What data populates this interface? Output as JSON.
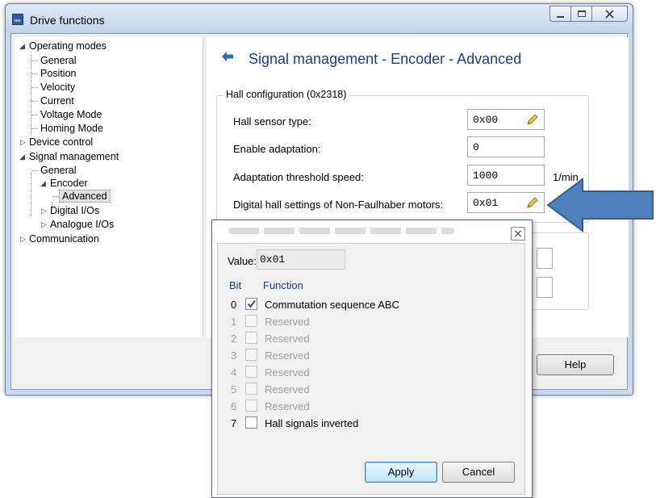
{
  "window": {
    "title": "Drive functions"
  },
  "tree": {
    "items": [
      {
        "label": "Operating modes",
        "expanded": true
      },
      {
        "label": "General"
      },
      {
        "label": "Position"
      },
      {
        "label": "Velocity"
      },
      {
        "label": "Current"
      },
      {
        "label": "Voltage Mode"
      },
      {
        "label": "Homing Mode"
      },
      {
        "label": "Device control",
        "expanded": false
      },
      {
        "label": "Signal management",
        "expanded": true
      },
      {
        "label": "General"
      },
      {
        "label": "Encoder",
        "expanded": true
      },
      {
        "label": "Advanced",
        "selected": true
      },
      {
        "label": "Digital I/Os",
        "expanded": false
      },
      {
        "label": "Analogue I/Os",
        "expanded": false
      },
      {
        "label": "Communication",
        "expanded": false
      }
    ]
  },
  "panel": {
    "title": "Signal management - Encoder - Advanced",
    "group_title": "Hall configuration (0x2318)",
    "fields": [
      {
        "label": "Hall sensor type:",
        "value": "0x00",
        "editable": true
      },
      {
        "label": "Enable adaptation:",
        "value": "0"
      },
      {
        "label": "Adaptation threshold speed:",
        "value": "1000",
        "unit": "1/min"
      },
      {
        "label": "Digital hall settings of Non-Faulhaber motors:",
        "value": "0x01",
        "editable": true
      }
    ],
    "help_label": "Help"
  },
  "dialog": {
    "value_label": "Value:",
    "value": "0x01",
    "col_bit": "Bit",
    "col_function": "Function",
    "bits": [
      {
        "bit": "0",
        "name": "Commutation sequence ABC",
        "checked": true,
        "enabled": true
      },
      {
        "bit": "1",
        "name": "Reserved",
        "checked": false,
        "enabled": false
      },
      {
        "bit": "2",
        "name": "Reserved",
        "checked": false,
        "enabled": false
      },
      {
        "bit": "3",
        "name": "Reserved",
        "checked": false,
        "enabled": false
      },
      {
        "bit": "4",
        "name": "Reserved",
        "checked": false,
        "enabled": false
      },
      {
        "bit": "5",
        "name": "Reserved",
        "checked": false,
        "enabled": false
      },
      {
        "bit": "6",
        "name": "Reserved",
        "checked": false,
        "enabled": false
      },
      {
        "bit": "7",
        "name": "Hall signals inverted",
        "checked": false,
        "enabled": true
      }
    ],
    "apply_label": "Apply",
    "cancel_label": "Cancel"
  },
  "colors": {
    "accent": "#1b3d8f",
    "arrow_fill": "#4f81bd",
    "arrow_stroke": "#385d8a",
    "window_frame": "#c9d9ec"
  }
}
